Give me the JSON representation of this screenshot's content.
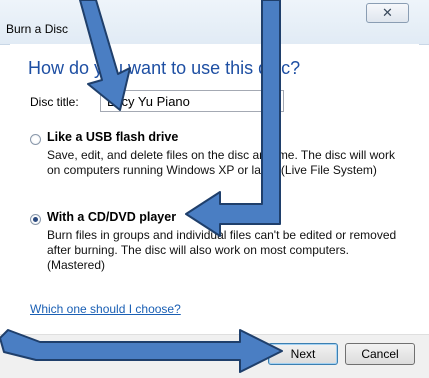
{
  "window": {
    "title": "Burn a Disc",
    "close_symbol": "✕"
  },
  "main": {
    "heading": "How do you want to use this disc?",
    "disc_title_label": "Disc title:",
    "disc_title_value": "Lucy Yu Piano",
    "options": [
      {
        "title": "Like a USB flash drive",
        "description": "Save, edit, and delete files on the disc anytime. The disc will work on computers running Windows XP or later. (Live File System)",
        "selected": false
      },
      {
        "title": "With a CD/DVD player",
        "description": "Burn files in groups and individual files can't be edited or removed after burning. The disc will also work on most computers. (Mastered)",
        "selected": true
      }
    ],
    "help_link": "Which one should I choose?"
  },
  "buttons": {
    "next": "Next",
    "cancel": "Cancel"
  },
  "colors": {
    "arrow_fill": "#4a7ec3",
    "arrow_stroke": "#1f3f6b",
    "heading": "#1e4fa3",
    "link": "#1a5fb4"
  }
}
